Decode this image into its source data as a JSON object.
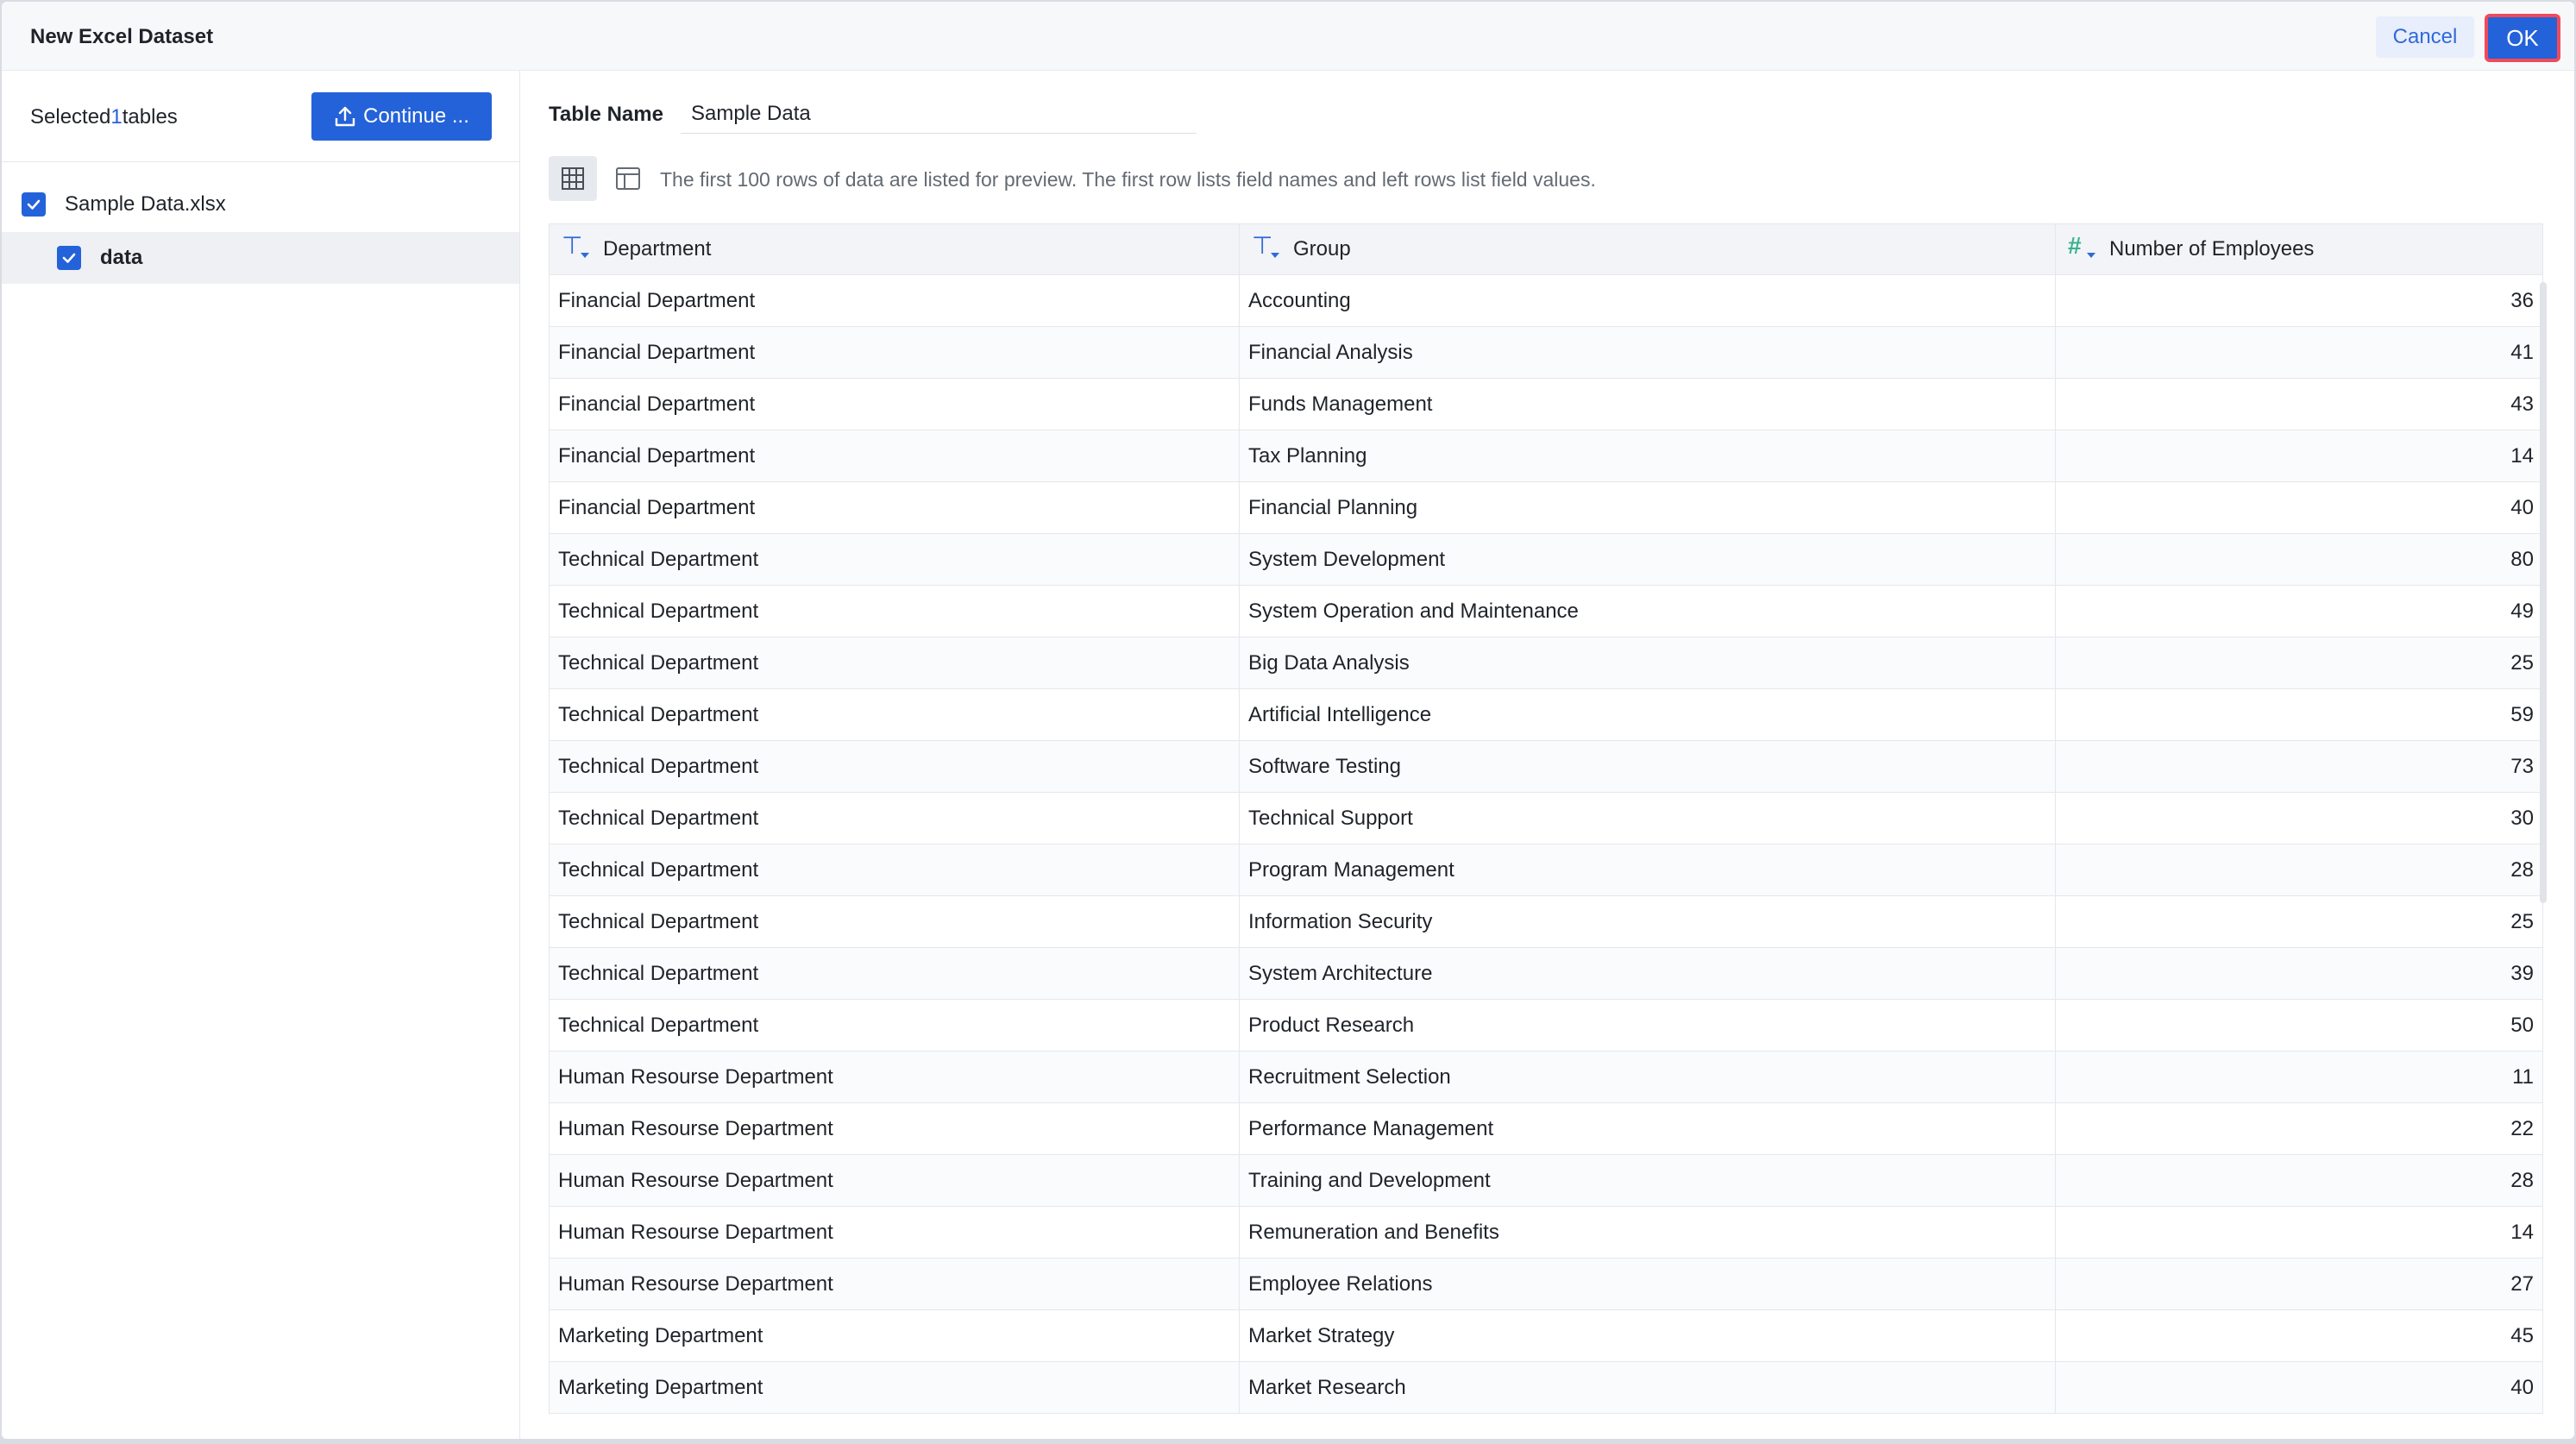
{
  "dialog": {
    "title": "New Excel Dataset",
    "cancel_label": "Cancel",
    "ok_label": "OK"
  },
  "sidebar": {
    "selected_prefix": "Selected",
    "selected_count": "1",
    "selected_suffix": "tables",
    "continue_label": "Continue ...",
    "file": {
      "name": "Sample Data.xlsx",
      "checked": true
    },
    "sheet": {
      "name": "data",
      "checked": true
    }
  },
  "main": {
    "table_name_label": "Table Name",
    "table_name_value": "Sample Data",
    "hint": "The first 100 rows of data are listed for preview. The first row lists field names and left rows list field values.",
    "icons": {
      "grid_view": "grid-view-icon",
      "form_view": "table-layout-icon",
      "text_type": "text-type-icon",
      "number_type": "number-type-icon"
    },
    "accent_color": "#2462d9"
  },
  "table": {
    "columns": [
      {
        "name": "Department",
        "type": "text"
      },
      {
        "name": "Group",
        "type": "text"
      },
      {
        "name": "Number of Employees",
        "type": "number"
      }
    ],
    "rows": [
      [
        "Financial Department",
        "Accounting",
        "36"
      ],
      [
        "Financial Department",
        "Financial Analysis",
        "41"
      ],
      [
        "Financial Department",
        "Funds Management",
        "43"
      ],
      [
        "Financial Department",
        "Tax Planning",
        "14"
      ],
      [
        "Financial Department",
        "Financial Planning",
        "40"
      ],
      [
        "Technical Department",
        "System Development",
        "80"
      ],
      [
        "Technical Department",
        "System Operation and Maintenance",
        "49"
      ],
      [
        "Technical Department",
        "Big Data Analysis",
        "25"
      ],
      [
        "Technical Department",
        "Artificial Intelligence",
        "59"
      ],
      [
        "Technical Department",
        "Software Testing",
        "73"
      ],
      [
        "Technical Department",
        "Technical Support",
        "30"
      ],
      [
        "Technical Department",
        "Program Management",
        "28"
      ],
      [
        "Technical Department",
        "Information Security",
        "25"
      ],
      [
        "Technical Department",
        "System Architecture",
        "39"
      ],
      [
        "Technical Department",
        "Product Research",
        "50"
      ],
      [
        "Human Resourse Department",
        "Recruitment Selection",
        "11"
      ],
      [
        "Human Resourse Department",
        "Performance Management",
        "22"
      ],
      [
        "Human Resourse Department",
        "Training and Development",
        "28"
      ],
      [
        "Human Resourse Department",
        "Remuneration and Benefits",
        "14"
      ],
      [
        "Human Resourse Department",
        "Employee Relations",
        "27"
      ],
      [
        "Marketing Department",
        "Market Strategy",
        "45"
      ],
      [
        "Marketing Department",
        "Market Research",
        "40"
      ]
    ]
  }
}
